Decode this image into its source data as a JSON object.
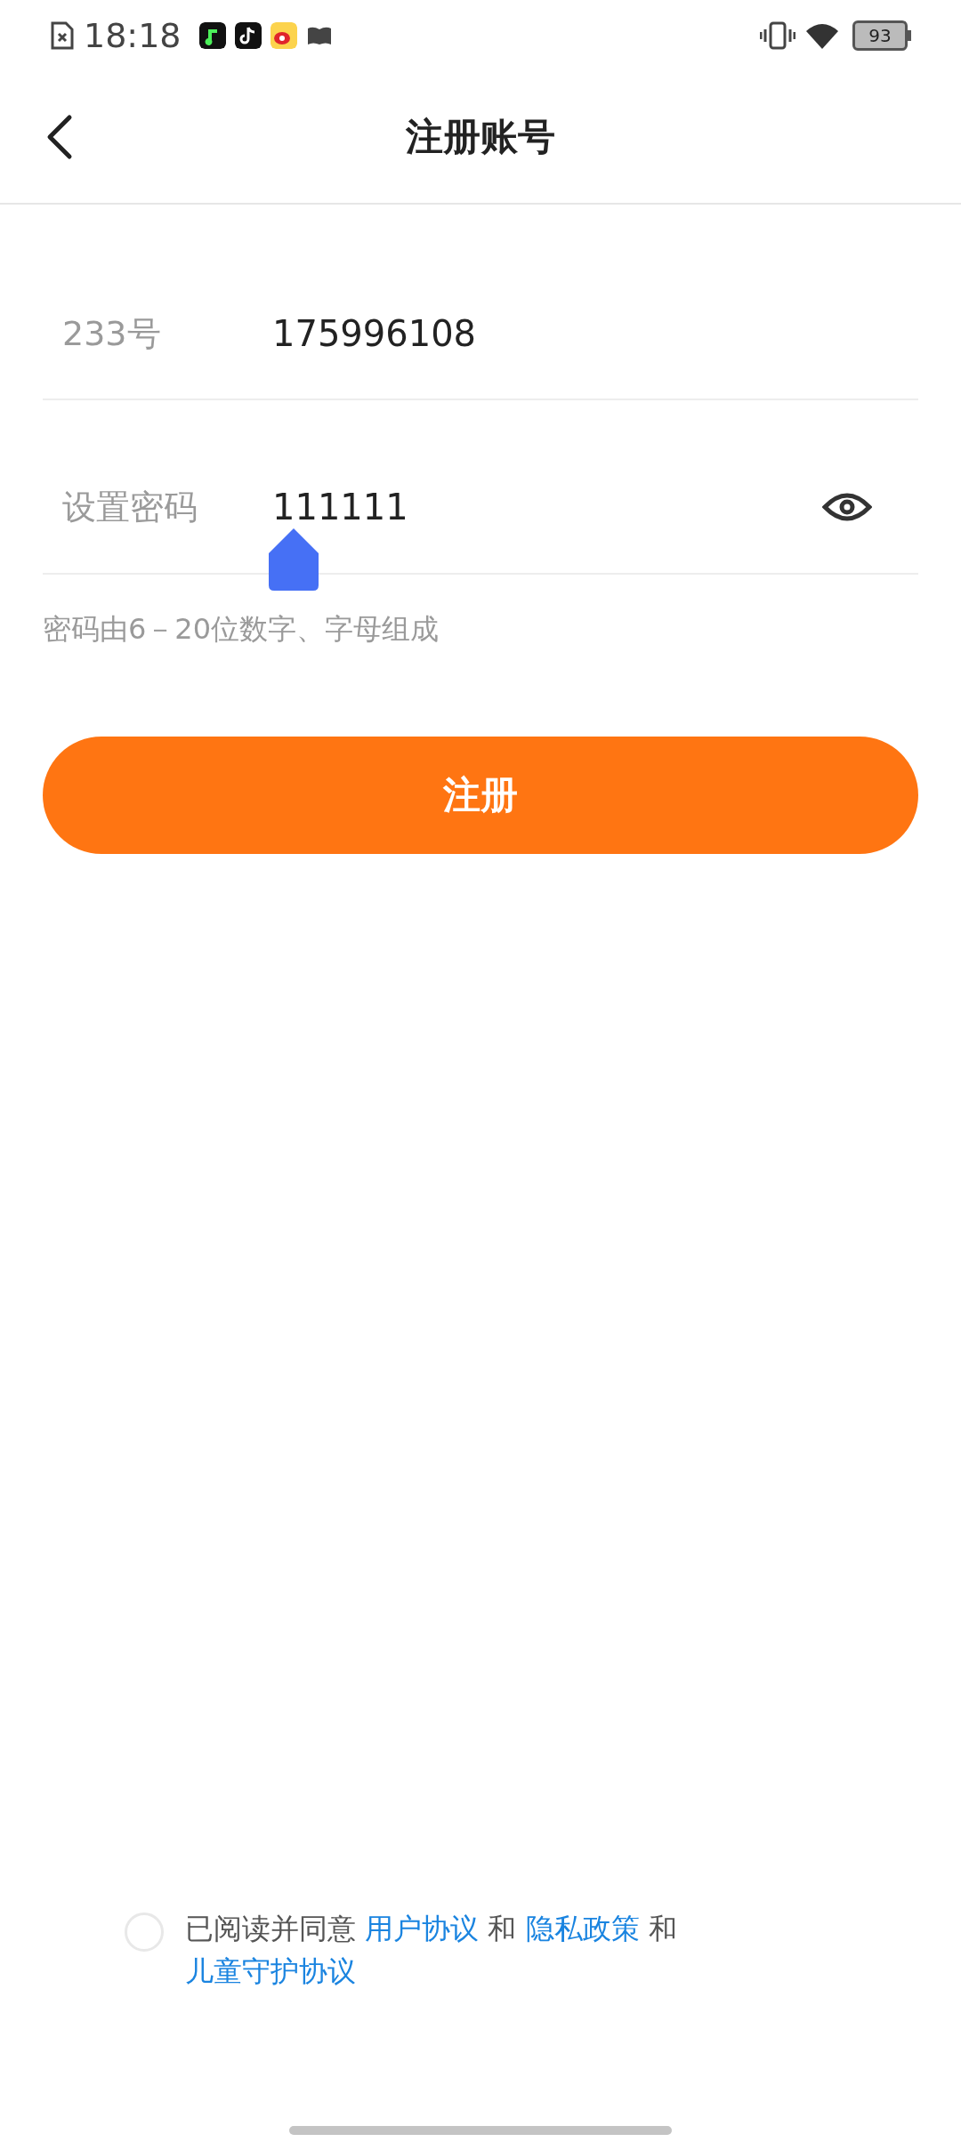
{
  "status_bar": {
    "time": "18:18",
    "battery": "93"
  },
  "header": {
    "title": "注册账号"
  },
  "fields": [
    {
      "label": "233号",
      "value": "175996108",
      "kind": "text",
      "focused": false
    },
    {
      "label": "设置密码",
      "value": "111111",
      "kind": "password",
      "focused": true
    }
  ],
  "hint": "密码由6－20位数字、字母组成",
  "submit_button": {
    "label": "注册"
  },
  "agreement": {
    "checked": false,
    "parts": [
      {
        "kind": "text",
        "text": "已阅读并同意"
      },
      {
        "kind": "link",
        "text": "用户协议"
      },
      {
        "kind": "text",
        "text": "和"
      },
      {
        "kind": "link",
        "text": "隐私政策"
      },
      {
        "kind": "text",
        "text": "和"
      },
      {
        "kind": "link",
        "text": "儿童守护协议"
      }
    ]
  }
}
